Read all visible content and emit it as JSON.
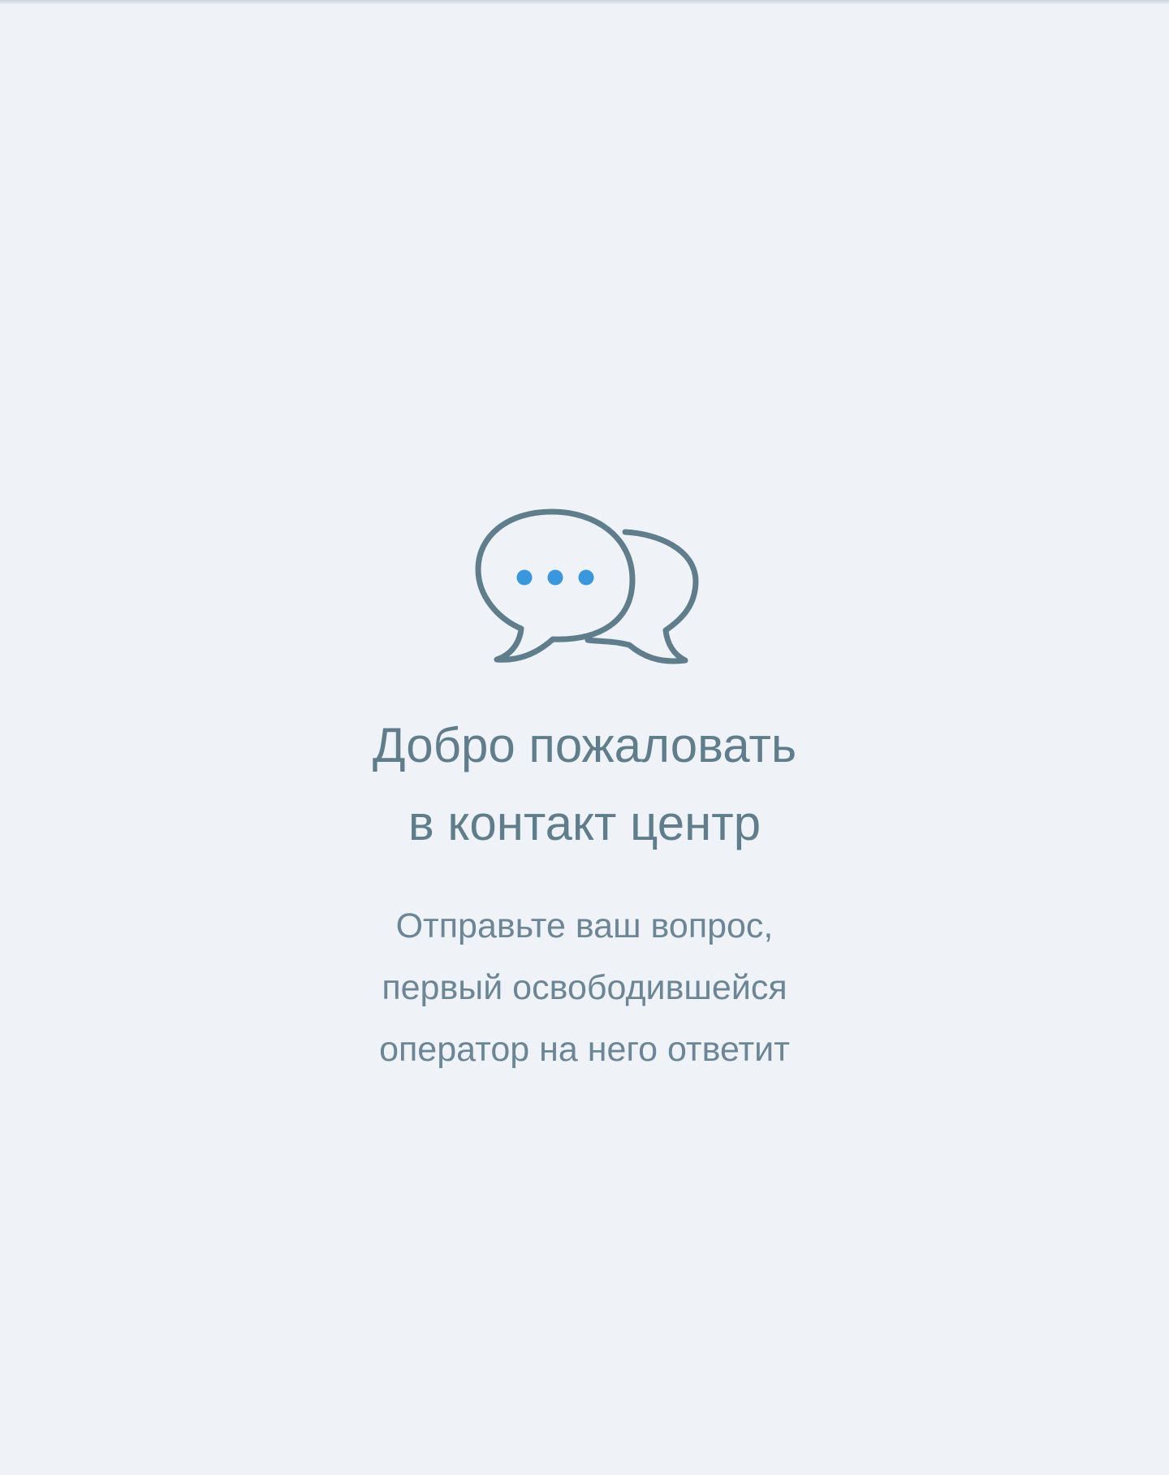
{
  "welcome": {
    "title_line_1": "Добро пожаловать",
    "title_line_2": "в контакт центр",
    "subtitle_line_1": "Отправьте ваш вопрос,",
    "subtitle_line_2": "первый освободившейся",
    "subtitle_line_3": "оператор на него ответит",
    "icon": "chat-bubbles-icon"
  },
  "colors": {
    "background": "#eff2f7",
    "text": "#607d8b",
    "icon_stroke": "#607d8b",
    "dots": "#3a97de"
  }
}
